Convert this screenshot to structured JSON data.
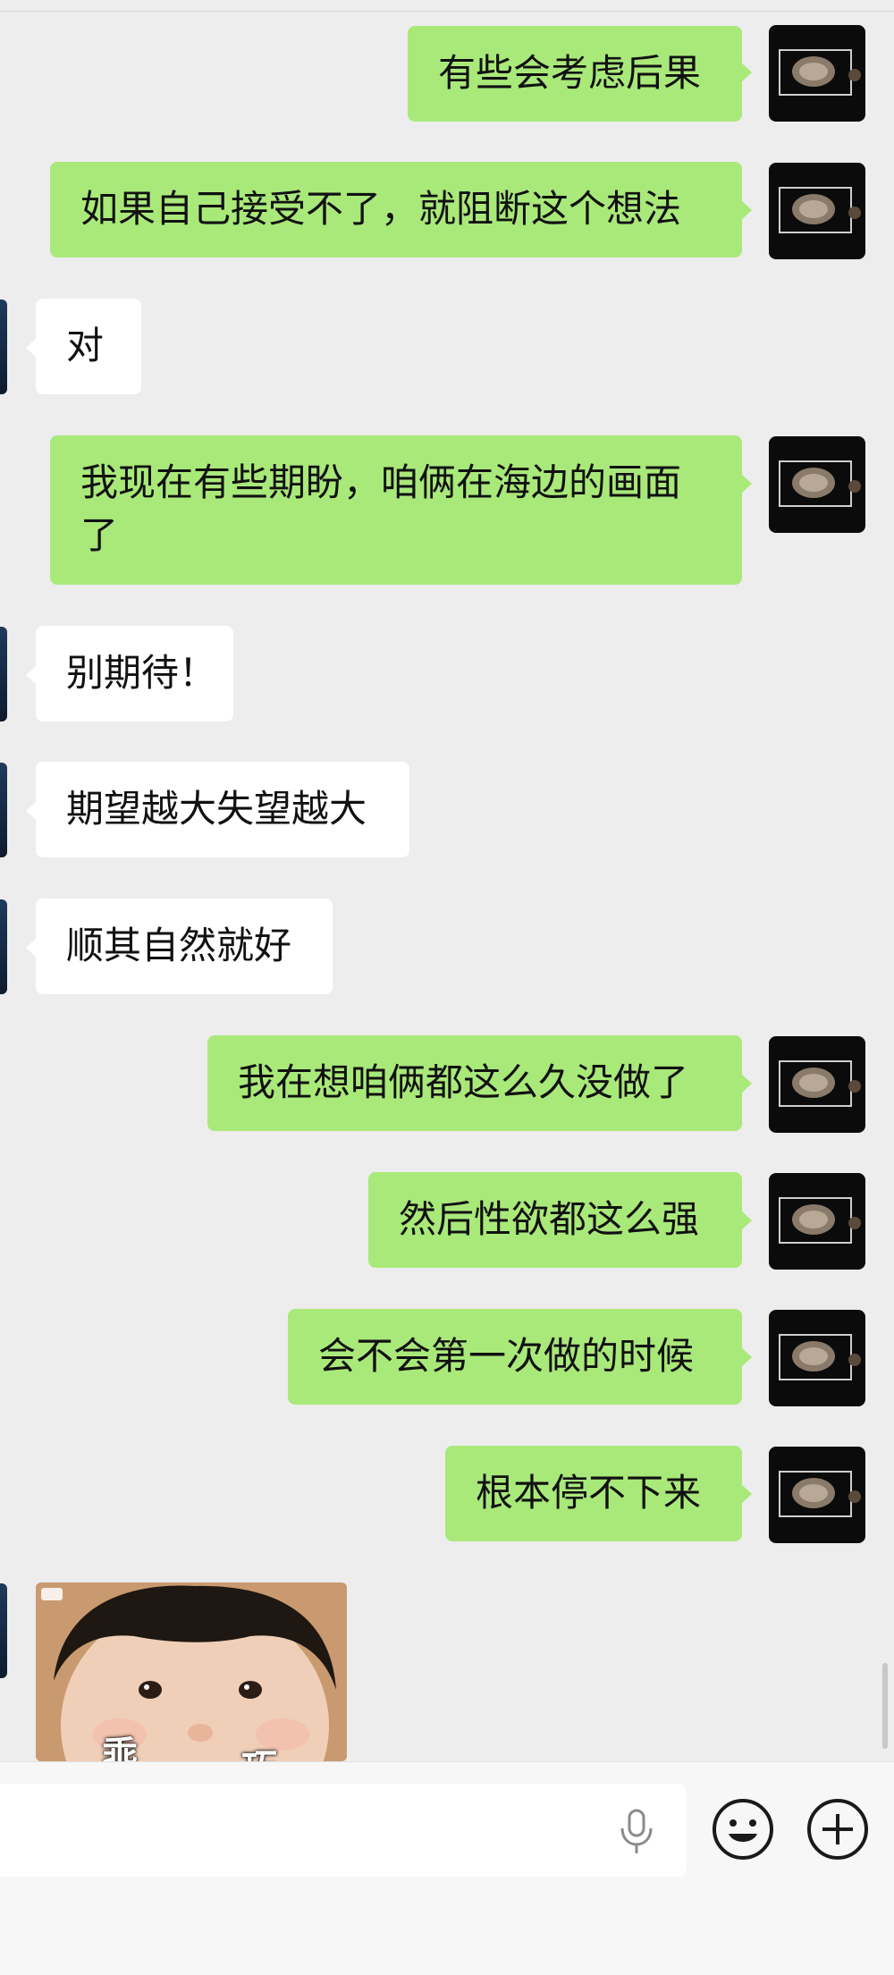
{
  "messages": [
    {
      "side": "sent",
      "text": "有些会考虑后果"
    },
    {
      "side": "sent",
      "text": "如果自己接受不了，就阻断这个想法"
    },
    {
      "side": "recv",
      "text": "对"
    },
    {
      "side": "sent",
      "text": "我现在有些期盼，咱俩在海边的画面了"
    },
    {
      "side": "recv",
      "text": "别期待！"
    },
    {
      "side": "recv",
      "text": "期望越大失望越大"
    },
    {
      "side": "recv",
      "text": "顺其自然就好"
    },
    {
      "side": "sent",
      "text": "我在想咱俩都这么久没做了"
    },
    {
      "side": "sent",
      "text": "然后性欲都这么强"
    },
    {
      "side": "sent",
      "text": "会不会第一次做的时候"
    },
    {
      "side": "sent",
      "text": "根本停不下来"
    }
  ],
  "sticker": {
    "caption_left": "乖",
    "caption_right": "巧"
  },
  "icons": {
    "voice": "microphone-icon",
    "emoji": "smiley-icon",
    "more": "plus-circle-icon"
  },
  "colors": {
    "sent_bubble": "#a9e97a",
    "recv_bubble": "#ffffff",
    "background": "#ededed"
  }
}
